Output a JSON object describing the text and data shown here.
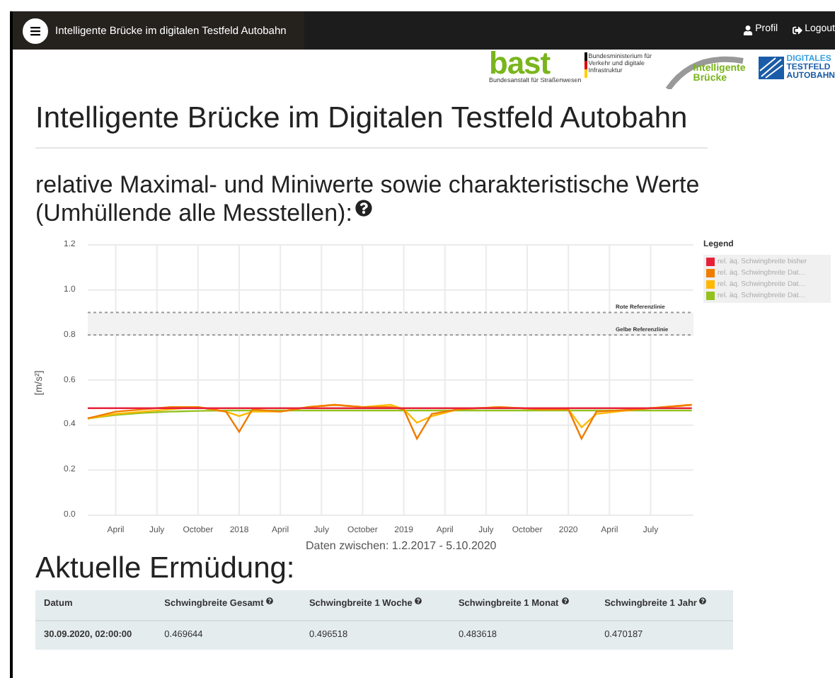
{
  "navbar": {
    "title": "Intelligente Brücke im digitalen Testfeld Autobahn",
    "links": [
      {
        "label": "Profil",
        "kind": "user"
      },
      {
        "label": "Logout",
        "kind": "logout"
      }
    ]
  },
  "logos": {
    "bast": {
      "name": "bast",
      "subtitle": "Bundesanstalt für Straßenwesen",
      "ministry": "Bundesministerium für Verkehr und digitale Infrastruktur"
    },
    "bridge": {
      "line1": "Intelligente",
      "line2": "Brücke"
    },
    "testfeld": {
      "line1": "DIGITALES",
      "line2": "TESTFELD",
      "line3": "AUTOBAHN"
    }
  },
  "page_title": "Intelligente Brücke im Digitalen Testfeld Autobahn",
  "section_title": "relative Maximal- und Miniwerte sowie charakteristische Werte (Umhüllende alle Messtellen):",
  "chart": {
    "legend_title": "Legend",
    "chart_data": {
      "type": "line",
      "xlabel": "Daten zwischen: 1.2.2017 - 5.10.2020",
      "ylabel": "[m/s²]",
      "x": [
        2017.08,
        2017.25,
        2017.42,
        2017.58,
        2017.75,
        2017.92,
        2018.0,
        2018.08,
        2018.25,
        2018.42,
        2018.58,
        2018.75,
        2018.92,
        2019.0,
        2019.08,
        2019.17,
        2019.33,
        2019.58,
        2019.83,
        2020.0,
        2020.08,
        2020.17,
        2020.42,
        2020.58,
        2020.75
      ],
      "series": [
        {
          "name": "rel. äq. Schwingbreite bisher",
          "color": "#e8213a",
          "values": [
            0.475,
            0.475,
            0.475,
            0.475,
            0.475,
            0.475,
            0.475,
            0.475,
            0.475,
            0.475,
            0.475,
            0.475,
            0.475,
            0.475,
            0.475,
            0.475,
            0.475,
            0.475,
            0.475,
            0.475,
            0.475,
            0.475,
            0.475,
            0.475,
            0.475
          ]
        },
        {
          "name": "rel. äq. Schwingbreite Dat…",
          "color": "#f07c00",
          "values": [
            0.43,
            0.46,
            0.47,
            0.48,
            0.48,
            0.46,
            0.37,
            0.47,
            0.46,
            0.48,
            0.49,
            0.48,
            0.48,
            0.47,
            0.34,
            0.45,
            0.47,
            0.48,
            0.47,
            0.47,
            0.34,
            0.46,
            0.47,
            0.48,
            0.49
          ]
        },
        {
          "name": "rel. äq. Schwingbreite Dat…",
          "color": "#ffb800",
          "values": [
            0.43,
            0.45,
            0.46,
            0.47,
            0.48,
            0.46,
            0.44,
            0.46,
            0.46,
            0.48,
            0.49,
            0.48,
            0.49,
            0.47,
            0.41,
            0.44,
            0.47,
            0.48,
            0.47,
            0.47,
            0.39,
            0.45,
            0.47,
            0.48,
            0.49
          ]
        },
        {
          "name": "rel. äq. Schwingbreite Dat…",
          "color": "#95c11f",
          "values": [
            0.43,
            0.445,
            0.455,
            0.46,
            0.463,
            0.465,
            0.465,
            0.465,
            0.465,
            0.465,
            0.465,
            0.465,
            0.465,
            0.465,
            0.465,
            0.465,
            0.465,
            0.465,
            0.465,
            0.465,
            0.465,
            0.465,
            0.465,
            0.465,
            0.465
          ]
        }
      ],
      "grid": true,
      "legend": "right",
      "xlim": [
        2017.08,
        2020.76
      ],
      "ylim": [
        0,
        1.2
      ],
      "xticks": [
        {
          "value": 2017.25,
          "label": "April"
        },
        {
          "value": 2017.5,
          "label": "July"
        },
        {
          "value": 2017.75,
          "label": "October"
        },
        {
          "value": 2018,
          "label": "2018"
        },
        {
          "value": 2018.25,
          "label": "April"
        },
        {
          "value": 2018.5,
          "label": "July"
        },
        {
          "value": 2018.75,
          "label": "October"
        },
        {
          "value": 2019,
          "label": "2019"
        },
        {
          "value": 2019.25,
          "label": "April"
        },
        {
          "value": 2019.5,
          "label": "July"
        },
        {
          "value": 2019.75,
          "label": "October"
        },
        {
          "value": 2020,
          "label": "2020"
        },
        {
          "value": 2020.25,
          "label": "April"
        },
        {
          "value": 2020.5,
          "label": "July"
        }
      ],
      "yticks": [
        {
          "value": 0,
          "label": "0.0"
        },
        {
          "value": 0.2,
          "label": "0.2"
        },
        {
          "value": 0.4,
          "label": "0.4"
        },
        {
          "value": 0.6,
          "label": "0.6"
        },
        {
          "value": 0.8,
          "label": "0.8"
        },
        {
          "value": 1,
          "label": "1.0"
        },
        {
          "value": 1.2,
          "label": "1.2"
        }
      ],
      "ref_lines": [
        {
          "axis": "y",
          "value": 0.9,
          "label": "Rote Referenzlinie"
        },
        {
          "axis": "y",
          "value": 0.8,
          "label": "Gelbe Referenzlinie"
        }
      ],
      "bands": [
        {
          "axis": "y",
          "from": 0.8,
          "to": 0.9
        }
      ]
    }
  },
  "fatigue_title": "Aktuelle Ermüdung:",
  "table": {
    "columns": [
      {
        "label": "Datum",
        "help": false
      },
      {
        "label": "Schwingbreite Gesamt",
        "help": true
      },
      {
        "label": "Schwingbreite 1 Woche",
        "help": true
      },
      {
        "label": "Schwingbreite 1 Monat",
        "help": true
      },
      {
        "label": "Schwingbreite 1 Jahr",
        "help": true
      }
    ],
    "rows": [
      [
        "30.09.2020, 02:00:00",
        "0.469644",
        "0.496518",
        "0.483618",
        "0.470187"
      ]
    ]
  }
}
